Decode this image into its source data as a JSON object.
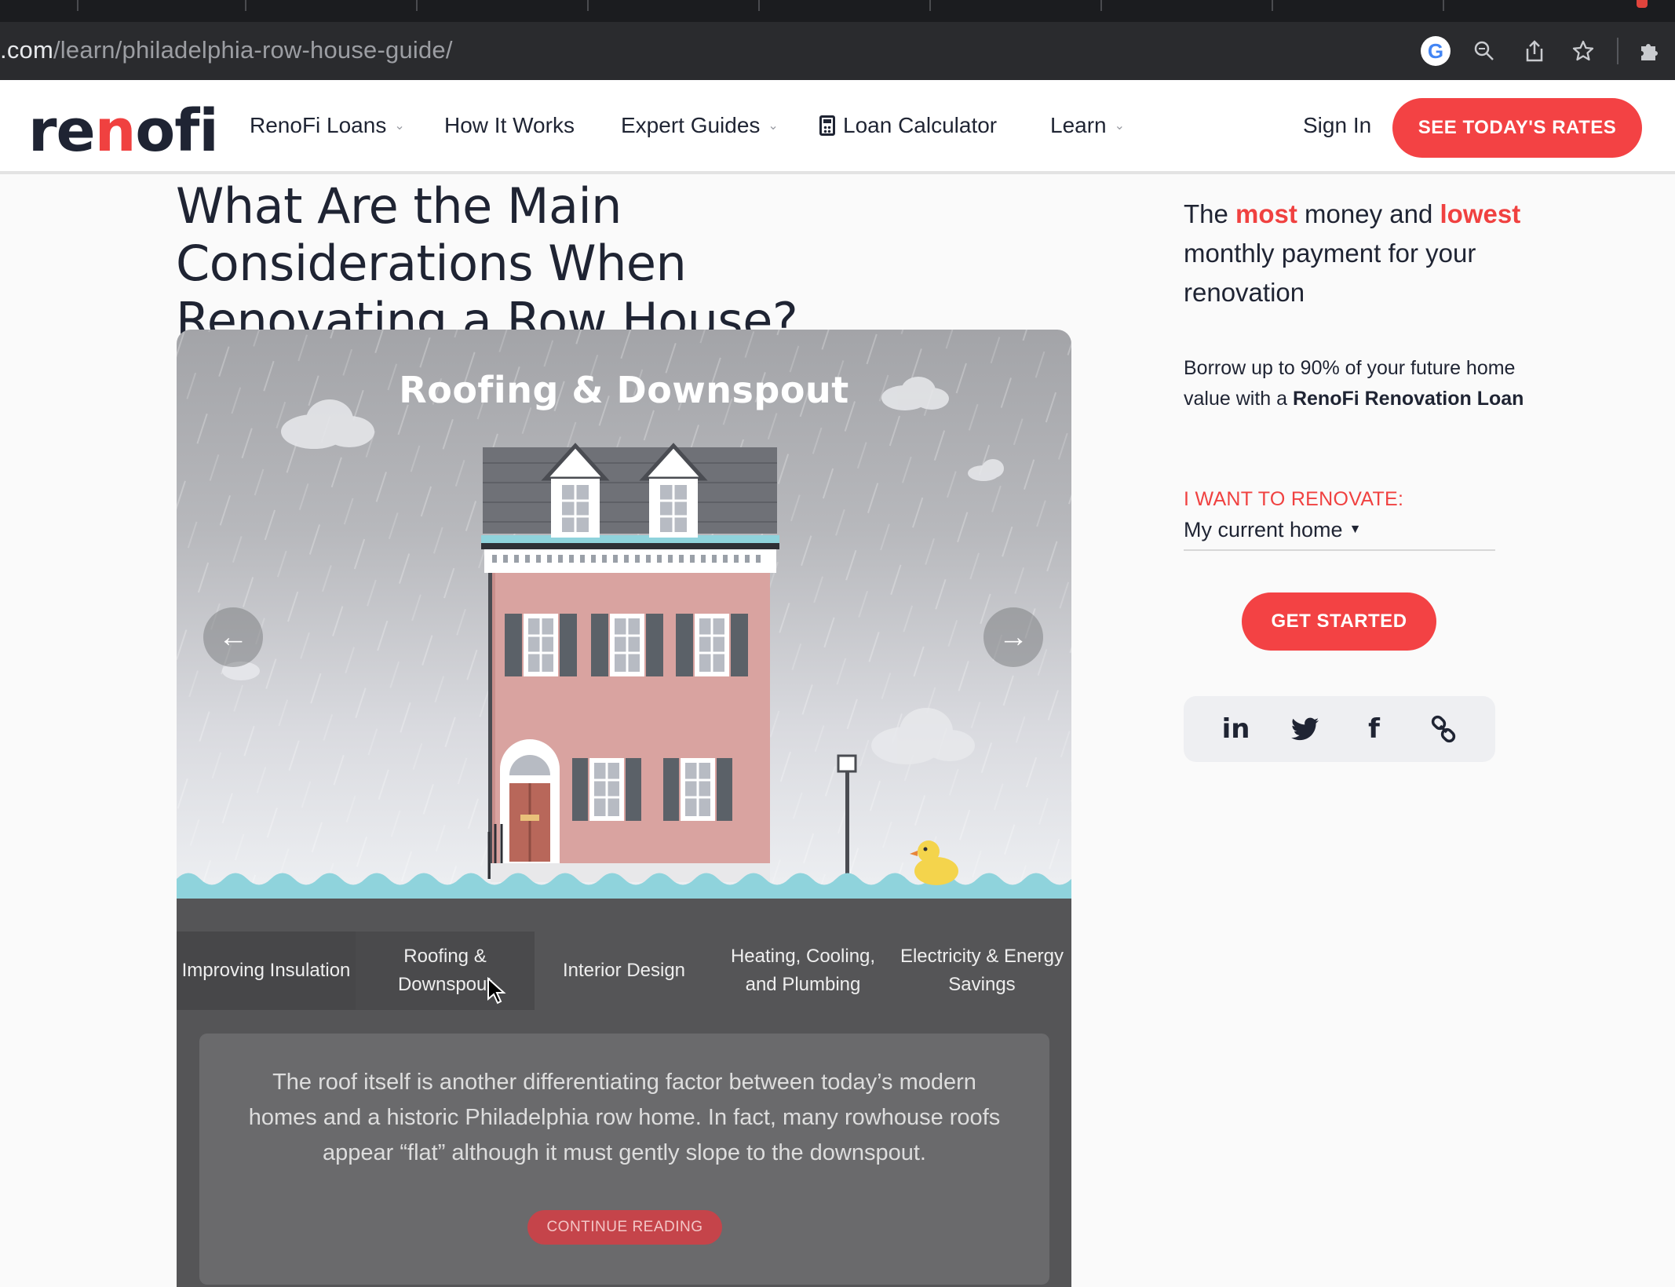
{
  "browser": {
    "url_host": ".com",
    "url_path": "/learn/philadelphia-row-house-guide/"
  },
  "header": {
    "logo": {
      "part1": "re",
      "part2": "n",
      "part3": "ofi"
    },
    "nav": [
      {
        "label": "RenoFi Loans",
        "has_dropdown": true
      },
      {
        "label": "How It Works",
        "has_dropdown": false
      },
      {
        "label": "Expert Guides",
        "has_dropdown": true
      },
      {
        "label": "Loan Calculator",
        "has_dropdown": false,
        "icon": "calculator-icon"
      },
      {
        "label": "Learn",
        "has_dropdown": true
      }
    ],
    "sign_in": "Sign In",
    "cta": "SEE TODAY'S RATES"
  },
  "article": {
    "title": "What Are the Main Considerations When Renovating a Row House?",
    "slider": {
      "slide_title": "Roofing & Downspout",
      "prev_icon": "arrow-left-icon",
      "next_icon": "arrow-right-icon"
    },
    "tabs": [
      {
        "label": "Improving Insulation"
      },
      {
        "label": "Roofing & Downspout",
        "active": true
      },
      {
        "label": "Interior Design"
      },
      {
        "label": "Heating, Cooling, and Plumbing"
      },
      {
        "label": "Electricity & Energy Savings"
      }
    ],
    "excerpt": "The roof itself is another differentiating factor between today’s modern homes and a historic Philadelphia row home. In fact, many rowhouse roofs appear “flat” although it must gently slope to the downspout.",
    "continue_label": "CONTINUE READING"
  },
  "sidebar": {
    "headline": {
      "p1": "The ",
      "most": "most",
      "p2": " money and ",
      "lowest": "lowest",
      "p3": " monthly payment for your renovation"
    },
    "body": {
      "p1": "Borrow up to 90% of your future home value with a ",
      "bold": "RenoFi Renovation Loan"
    },
    "renovate_label": "I WANT TO RENOVATE:",
    "renovate_value": "My current home",
    "get_started": "GET STARTED",
    "share": [
      "linkedin-icon",
      "twitter-icon",
      "facebook-icon",
      "link-icon"
    ]
  },
  "colors": {
    "brand_red": "#f34244",
    "text_dark": "#1f2433",
    "tab_panel": "#555557"
  }
}
